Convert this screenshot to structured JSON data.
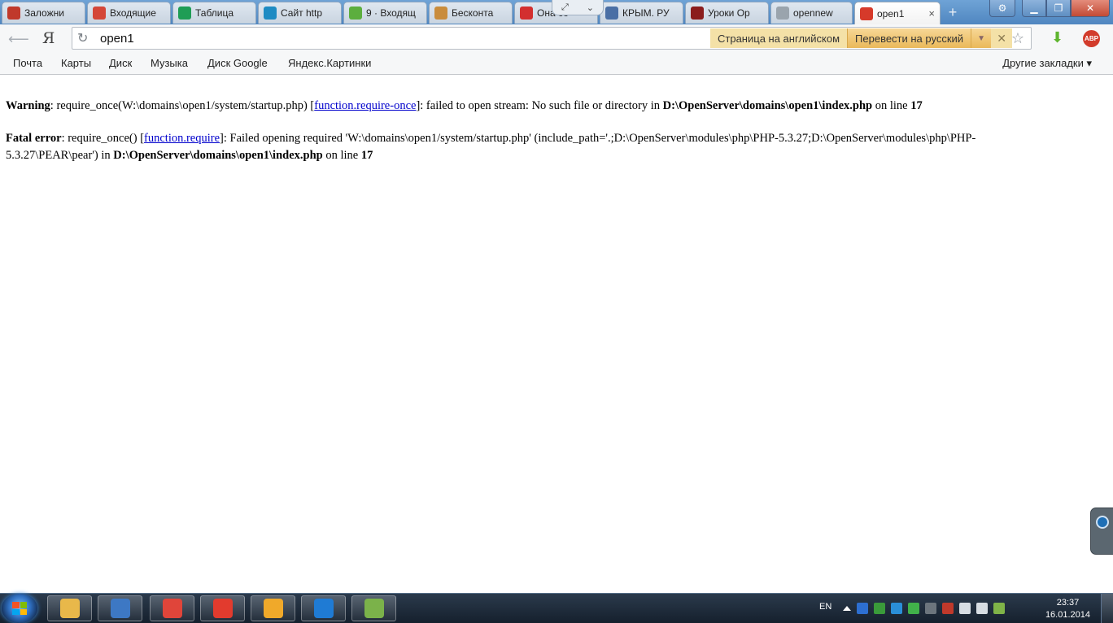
{
  "tabs": [
    {
      "title": "Заложни",
      "favicon": "ghost-icon",
      "color": "#c0392b"
    },
    {
      "title": "Входящие",
      "favicon": "gmail-icon",
      "color": "#d44638"
    },
    {
      "title": "Таблица",
      "favicon": "sheets-icon",
      "color": "#1f9d55"
    },
    {
      "title": "Сайт http",
      "favicon": "site-icon",
      "color": "#1e8bc3"
    },
    {
      "title": "9 · Входящ",
      "favicon": "mail-icon",
      "color": "#5cae3e"
    },
    {
      "title": "Бесконта",
      "favicon": "vitruvian-icon",
      "color": "#c98c3c"
    },
    {
      "title": "Она со",
      "favicon": "youtube-icon",
      "color": "#d32f2f"
    },
    {
      "title": "КРЫМ. РУ",
      "favicon": "crimea-icon",
      "color": "#4a6fa5"
    },
    {
      "title": "Уроки Op",
      "favicon": "lessons-icon",
      "color": "#8b1d1d"
    },
    {
      "title": "opennew",
      "favicon": "page-icon",
      "color": "#9aa4ad"
    },
    {
      "title": "open1",
      "favicon": "error-page-icon",
      "color": "#d63a2a",
      "active": true
    }
  ],
  "toolbar": {
    "url": "open1",
    "translate_from": "Страница на английском",
    "translate_to": "Перевести на русский",
    "yandex_glyph": "Я"
  },
  "bookmarks": {
    "items": [
      "Почта",
      "Карты",
      "Диск",
      "Музыка",
      "Диск Google",
      "Яндекс.Картинки"
    ],
    "other": "Другие закладки ▾"
  },
  "page": {
    "warning": {
      "label": "Warning",
      "text1": ": require_once(W:\\domains\\open1/system/startup.php) [",
      "link": "function.require-once",
      "text2": "]: failed to open stream: No such file or directory in ",
      "path": "D:\\OpenServer\\domains\\open1\\index.php",
      "text3": " on line ",
      "line": "17"
    },
    "fatal": {
      "label": "Fatal error",
      "text1": ": require_once() [",
      "link": "function.require",
      "text2": "]: Failed opening required 'W:\\domains\\open1/system/startup.php' (include_path='.;D:\\OpenServer\\modules\\php\\PHP-5.3.27;D:\\OpenServer\\modules\\php\\PHP-5.3.27\\PEAR\\pear') in ",
      "path": "D:\\OpenServer\\domains\\open1\\index.php",
      "text3": " on line ",
      "line": "17"
    }
  },
  "taskbar": {
    "apps": [
      {
        "name": "explorer-icon",
        "color": "#e8b84a"
      },
      {
        "name": "notepad-icon",
        "color": "#3d78c4"
      },
      {
        "name": "chrome-icon",
        "color": "#e0453a"
      },
      {
        "name": "yandex-browser-icon",
        "color": "#e23b2e"
      },
      {
        "name": "folder-app-icon",
        "color": "#f0a92a"
      },
      {
        "name": "teamviewer-icon",
        "color": "#1f7bd4"
      },
      {
        "name": "notepadpp-icon",
        "color": "#7bb24a"
      }
    ],
    "lang": "EN",
    "time": "23:37",
    "date": "16.01.2014"
  }
}
